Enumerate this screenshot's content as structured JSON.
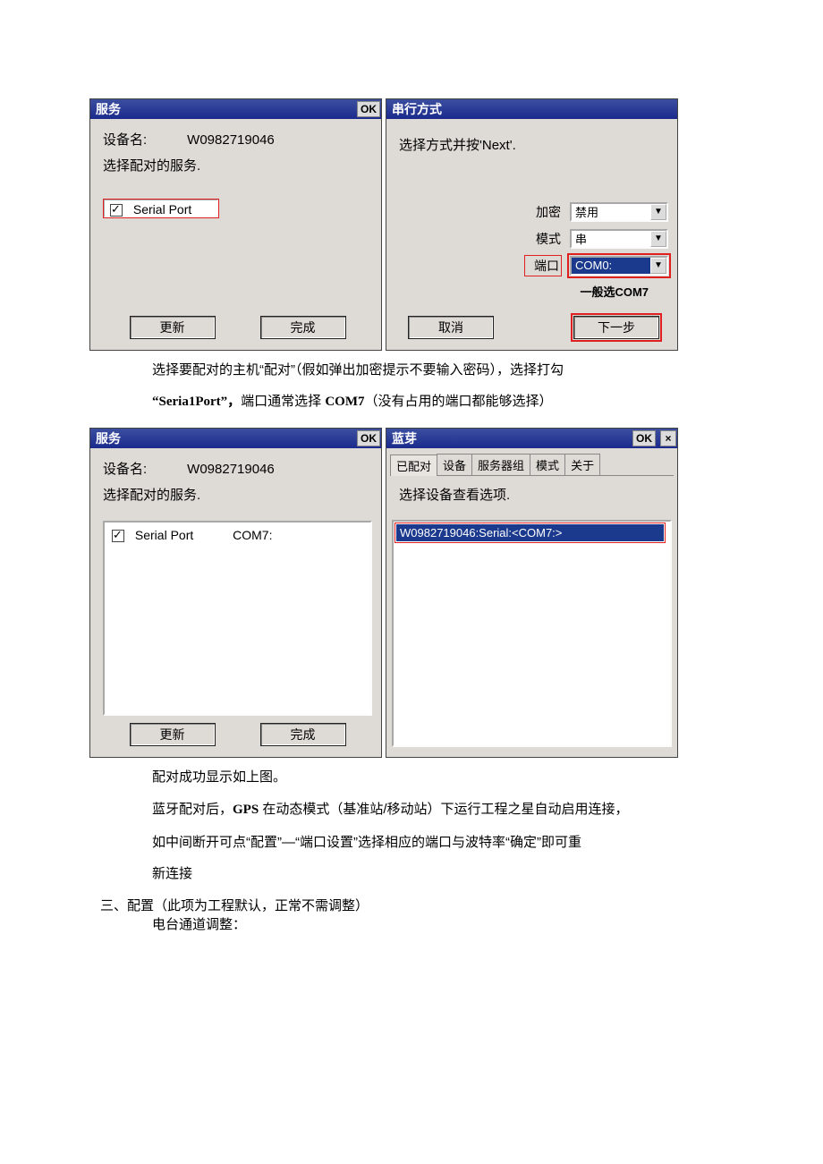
{
  "figure1": {
    "service_panel": {
      "title": "服务",
      "ok": "OK",
      "device_label": "设备名:",
      "device_value": "W0982719046",
      "prompt": "选择配对的服务.",
      "item": "Serial Port",
      "btn_update": "更新",
      "btn_done": "完成"
    },
    "serial_panel": {
      "title": "串行方式",
      "prompt": "选择方式并按'Next'.",
      "encrypt_label": "加密",
      "encrypt_value": "禁用",
      "mode_label": "模式",
      "mode_value": "串",
      "port_label": "端口",
      "port_value": "COM0:",
      "note": "一般选COM7",
      "btn_cancel": "取消",
      "btn_next": "下一步"
    }
  },
  "caption1a": "选择要配对的主机“配对”（假如弹出加密提示不要输入密码），选择打勾",
  "caption1b_bold": "“Seria1Port”，",
  "caption1b_rest1": "端口通常选择 ",
  "caption1b_bold2": "COM7",
  "caption1b_rest2": "（没有占用的端口都能够选择）",
  "figure2": {
    "service_panel": {
      "title": "服务",
      "ok": "OK",
      "device_label": "设备名:",
      "device_value": "W0982719046",
      "prompt": "选择配对的服务.",
      "item": "Serial Port",
      "item_port": "COM7:",
      "btn_update": "更新",
      "btn_done": "完成"
    },
    "bt_panel": {
      "title": "蓝芽",
      "ok": "OK",
      "x": "×",
      "tabs": [
        "已配对",
        "设备",
        "服务器组",
        "模式",
        "关于"
      ],
      "prompt": "选择设备查看选项.",
      "selected_item": "W0982719046:Serial:<COM7:>"
    }
  },
  "caption2a": "配对成功显示如上图。",
  "caption2b_pre": "蓝牙配对后，",
  "caption2b_bold": "GPS",
  "caption2b_rest": " 在动态模式（基准站/移动站）下运行工程之星自动启用连接，",
  "caption2c": "如中间断开可点“配置”—“端口设置”选择相应的端口与波特率“确定”即可重",
  "caption2d": "新连接",
  "heading": "三、配置（此项为工程默认，正常不需调整）",
  "sub": "电台通道调整："
}
